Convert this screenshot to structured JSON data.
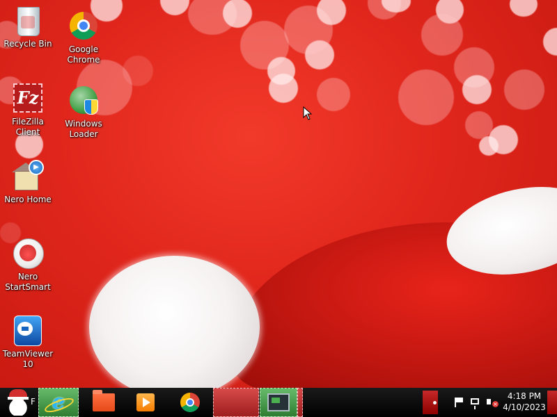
{
  "desktop": {
    "icons": [
      {
        "label": "Recycle Bin",
        "icon": "recycle-bin-icon"
      },
      {
        "label": "Google Chrome",
        "icon": "google-chrome-icon"
      },
      {
        "label": "FileZilla Client",
        "icon": "filezilla-icon"
      },
      {
        "label": "Windows Loader",
        "icon": "windows-loader-icon"
      },
      {
        "label": "Nero Home",
        "icon": "nero-home-icon"
      },
      {
        "label": "Nero StartSmart",
        "icon": "nero-startsmart-icon"
      },
      {
        "label": "TeamViewer 10",
        "icon": "teamviewer-icon"
      }
    ],
    "filezilla_logo_text": "Fz",
    "accent_color": "#e0261c"
  },
  "taskbar": {
    "start_label": "F",
    "pinned": [
      {
        "name": "Internet Explorer",
        "icon": "internet-explorer-icon"
      },
      {
        "name": "File Explorer",
        "icon": "folder-icon"
      },
      {
        "name": "Windows Media Player",
        "icon": "media-player-icon"
      },
      {
        "name": "Google Chrome",
        "icon": "chrome-icon"
      },
      {
        "name": "Remote Desktop",
        "icon": "monitor-icon"
      }
    ],
    "ie_glyph": "e",
    "tray": {
      "time": "4:18 PM",
      "date": "4/10/2023",
      "mute_glyph": "×"
    }
  }
}
